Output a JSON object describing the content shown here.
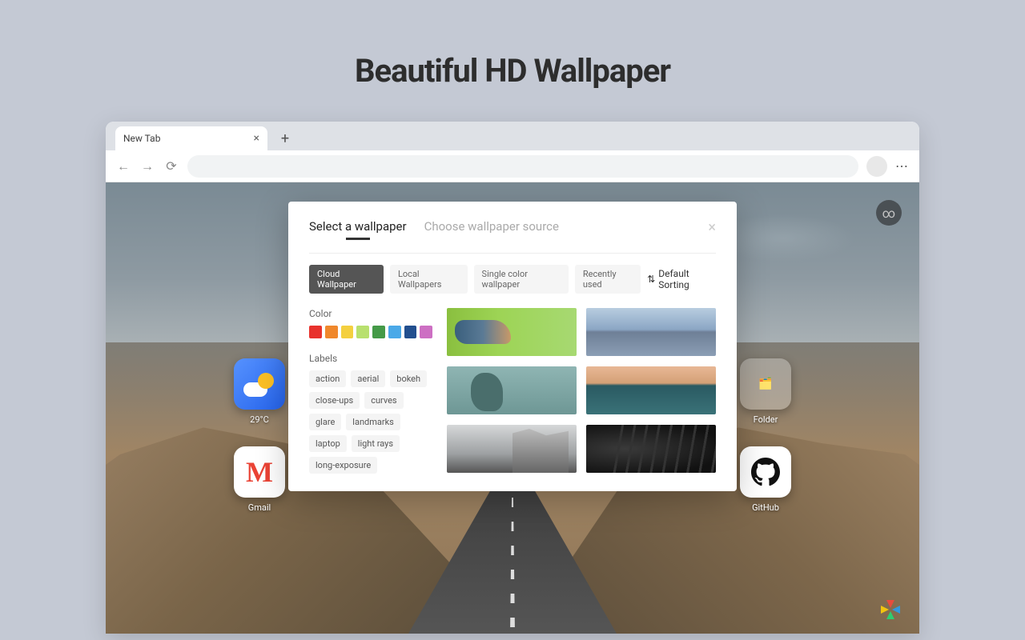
{
  "hero": {
    "title": "Beautiful HD Wallpaper"
  },
  "browser": {
    "tab_name": "New Tab",
    "close_glyph": "×",
    "plus_glyph": "+",
    "back_glyph": "←",
    "forward_glyph": "→",
    "reload_glyph": "⟳",
    "menu_glyph": "⋯"
  },
  "infinity_glyph": "∞",
  "desktop": {
    "weather_label": "29°C",
    "folder_label": "Folder",
    "gmail_label": "Gmail",
    "gmail_glyph": "M",
    "github_label": "GitHub",
    "github_glyph": "◐"
  },
  "modal": {
    "tabs": {
      "select": "Select a wallpaper",
      "source": "Choose wallpaper source"
    },
    "close_glyph": "×",
    "sources": {
      "cloud": "Cloud Wallpaper",
      "local": "Local Wallpapers",
      "single": "Single color wallpaper",
      "recent": "Recently used"
    },
    "sort_glyph": "⇅",
    "sort_label": "Default Sorting",
    "color_heading": "Color",
    "labels_heading": "Labels",
    "colors": [
      "#e8322d",
      "#f0882c",
      "#f4d03f",
      "#b8e06e",
      "#459a48",
      "#4aa9e8",
      "#224f8e",
      "#cd6fc3"
    ],
    "labels": [
      "action",
      "aerial",
      "bokeh",
      "close-ups",
      "curves",
      "glare",
      "landmarks",
      "laptop",
      "light rays",
      "long-exposure"
    ]
  }
}
